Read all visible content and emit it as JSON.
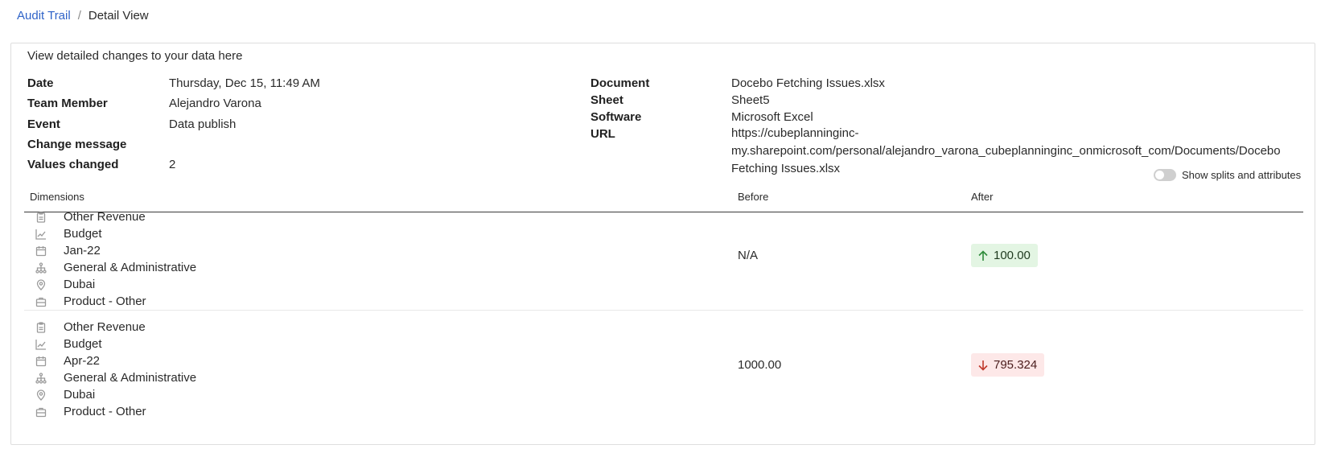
{
  "breadcrumb": {
    "parent": "Audit Trail",
    "separator": "/",
    "current": "Detail View"
  },
  "intro": "View detailed changes to your data here",
  "meta_left": {
    "date_label": "Date",
    "date_value": "Thursday, Dec 15, 11:49 AM",
    "member_label": "Team Member",
    "member_value": "Alejandro Varona",
    "event_label": "Event",
    "event_value": "Data publish",
    "message_label": "Change message",
    "message_value": "",
    "values_label": "Values changed",
    "values_value": "2"
  },
  "meta_right": {
    "document_label": "Document",
    "document_value": "Docebo Fetching Issues.xlsx",
    "sheet_label": "Sheet",
    "sheet_value": "Sheet5",
    "software_label": "Software",
    "software_value": "Microsoft Excel",
    "url_label": "URL",
    "url_value": "https://cubeplanninginc-my.sharepoint.com/personal/alejandro_varona_cubeplanninginc_onmicrosoft_com/Documents/Docebo Fetching Issues.xlsx"
  },
  "toggle": {
    "label": "Show splits and attributes",
    "on": false
  },
  "table": {
    "columns": {
      "dimensions": "Dimensions",
      "before": "Before",
      "after": "After"
    },
    "rows": [
      {
        "dimensions": [
          {
            "icon": "clipboard-icon",
            "label": "Other Revenue"
          },
          {
            "icon": "line-chart-icon",
            "label": "Budget"
          },
          {
            "icon": "calendar-icon",
            "label": "Jan-22"
          },
          {
            "icon": "hierarchy-icon",
            "label": "General & Administrative"
          },
          {
            "icon": "location-pin-icon",
            "label": "Dubai"
          },
          {
            "icon": "briefcase-icon",
            "label": "Product - Other"
          }
        ],
        "before": "N/A",
        "after": "100.00",
        "direction": "up"
      },
      {
        "dimensions": [
          {
            "icon": "clipboard-icon",
            "label": "Other Revenue"
          },
          {
            "icon": "line-chart-icon",
            "label": "Budget"
          },
          {
            "icon": "calendar-icon",
            "label": "Apr-22"
          },
          {
            "icon": "hierarchy-icon",
            "label": "General & Administrative"
          },
          {
            "icon": "location-pin-icon",
            "label": "Dubai"
          },
          {
            "icon": "briefcase-icon",
            "label": "Product - Other"
          }
        ],
        "before": "1000.00",
        "after": "795.324",
        "direction": "down"
      }
    ]
  },
  "colors": {
    "link": "#2f63c8",
    "increase_bg": "#e3f5e3",
    "decrease_bg": "#fde8e8",
    "increase_arrow": "#2e8b3a",
    "decrease_arrow": "#c0392b"
  }
}
